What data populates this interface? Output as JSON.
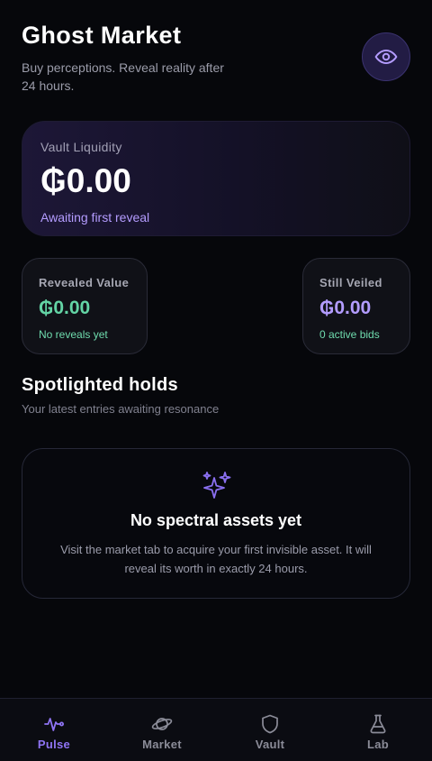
{
  "header": {
    "title": "Ghost Market",
    "subtitle": "Buy perceptions. Reveal reality after 24 hours.",
    "reveal_icon": "eye-icon"
  },
  "liquidity": {
    "label": "Vault Liquidity",
    "value": "₲0.00",
    "note": "Awaiting first reveal"
  },
  "stats": {
    "revealed": {
      "label": "Revealed Value",
      "value": "₲0.00",
      "note": "No reveals yet"
    },
    "veiled": {
      "label": "Still Veiled",
      "value": "₲0.00",
      "note": "0 active bids"
    }
  },
  "holds": {
    "title": "Spotlighted holds",
    "subtitle": "Your latest entries awaiting resonance",
    "empty": {
      "icon": "sparkles-icon",
      "title": "No spectral assets yet",
      "text": "Visit the market tab to acquire your first invisible asset. It will reveal its worth in exactly 24 hours."
    }
  },
  "tabs": [
    {
      "label": "Pulse",
      "icon": "pulse-icon",
      "active": true
    },
    {
      "label": "Market",
      "icon": "planet-icon",
      "active": false
    },
    {
      "label": "Vault",
      "icon": "shield-icon",
      "active": false
    },
    {
      "label": "Lab",
      "icon": "flask-icon",
      "active": false
    }
  ],
  "colors": {
    "accent": "#8f74f4",
    "positive": "#63d4a5",
    "veiled": "#b39cff",
    "background": "#06070b"
  }
}
